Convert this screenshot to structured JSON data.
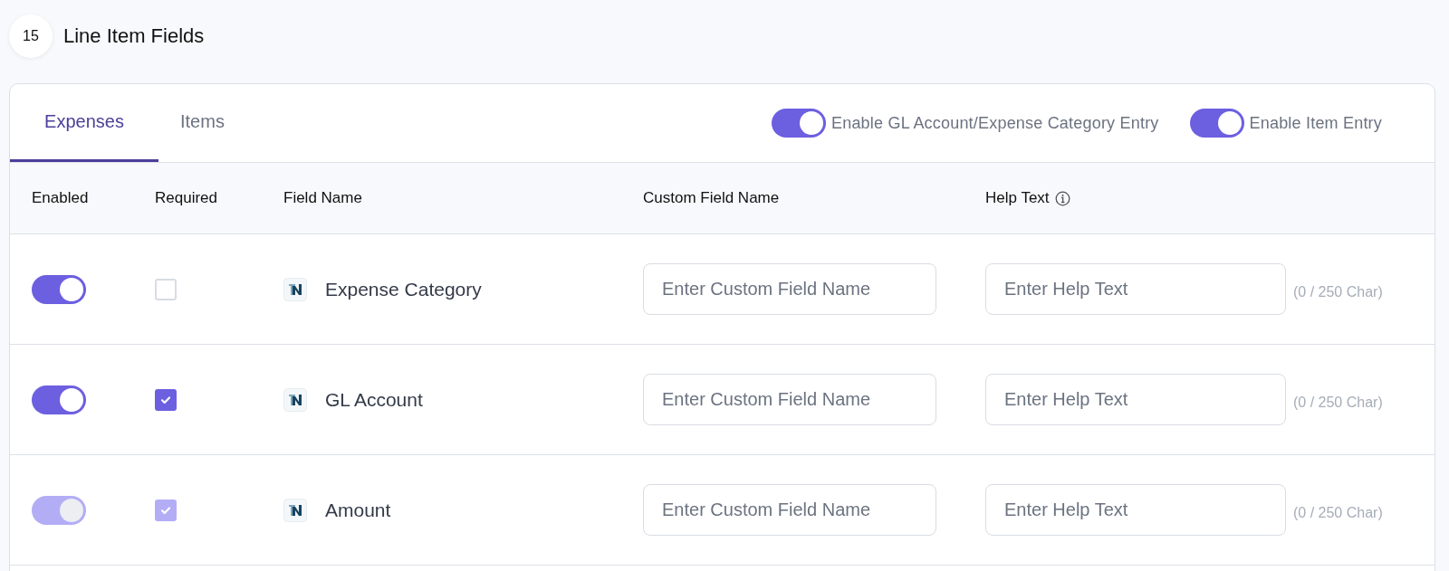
{
  "section": {
    "number": "15",
    "title": "Line Item Fields"
  },
  "tabs": [
    {
      "label": "Expenses",
      "selected": true
    },
    {
      "label": "Items",
      "selected": false
    }
  ],
  "switches": [
    {
      "label": "Enable GL Account/Expense Category Entry",
      "on": true
    },
    {
      "label": "Enable Item Entry",
      "on": true
    }
  ],
  "table": {
    "columns": [
      "Enabled",
      "Required",
      "Field Name",
      "Custom Field Name",
      "Help Text"
    ],
    "rows": [
      {
        "enabled": true,
        "required": false,
        "disabled": false,
        "field_name": "Expense Category",
        "custom_placeholder": "Enter Custom Field Name",
        "help_placeholder": "Enter Help Text",
        "counter": "(0 / 250 Char)"
      },
      {
        "enabled": true,
        "required": true,
        "disabled": false,
        "field_name": "GL Account",
        "custom_placeholder": "Enter Custom Field Name",
        "help_placeholder": "Enter Help Text",
        "counter": "(0 / 250 Char)"
      },
      {
        "enabled": true,
        "required": true,
        "disabled": true,
        "field_name": "Amount",
        "custom_placeholder": "Enter Custom Field Name",
        "help_placeholder": "Enter Help Text",
        "counter": "(0 / 250 Char)"
      }
    ]
  }
}
